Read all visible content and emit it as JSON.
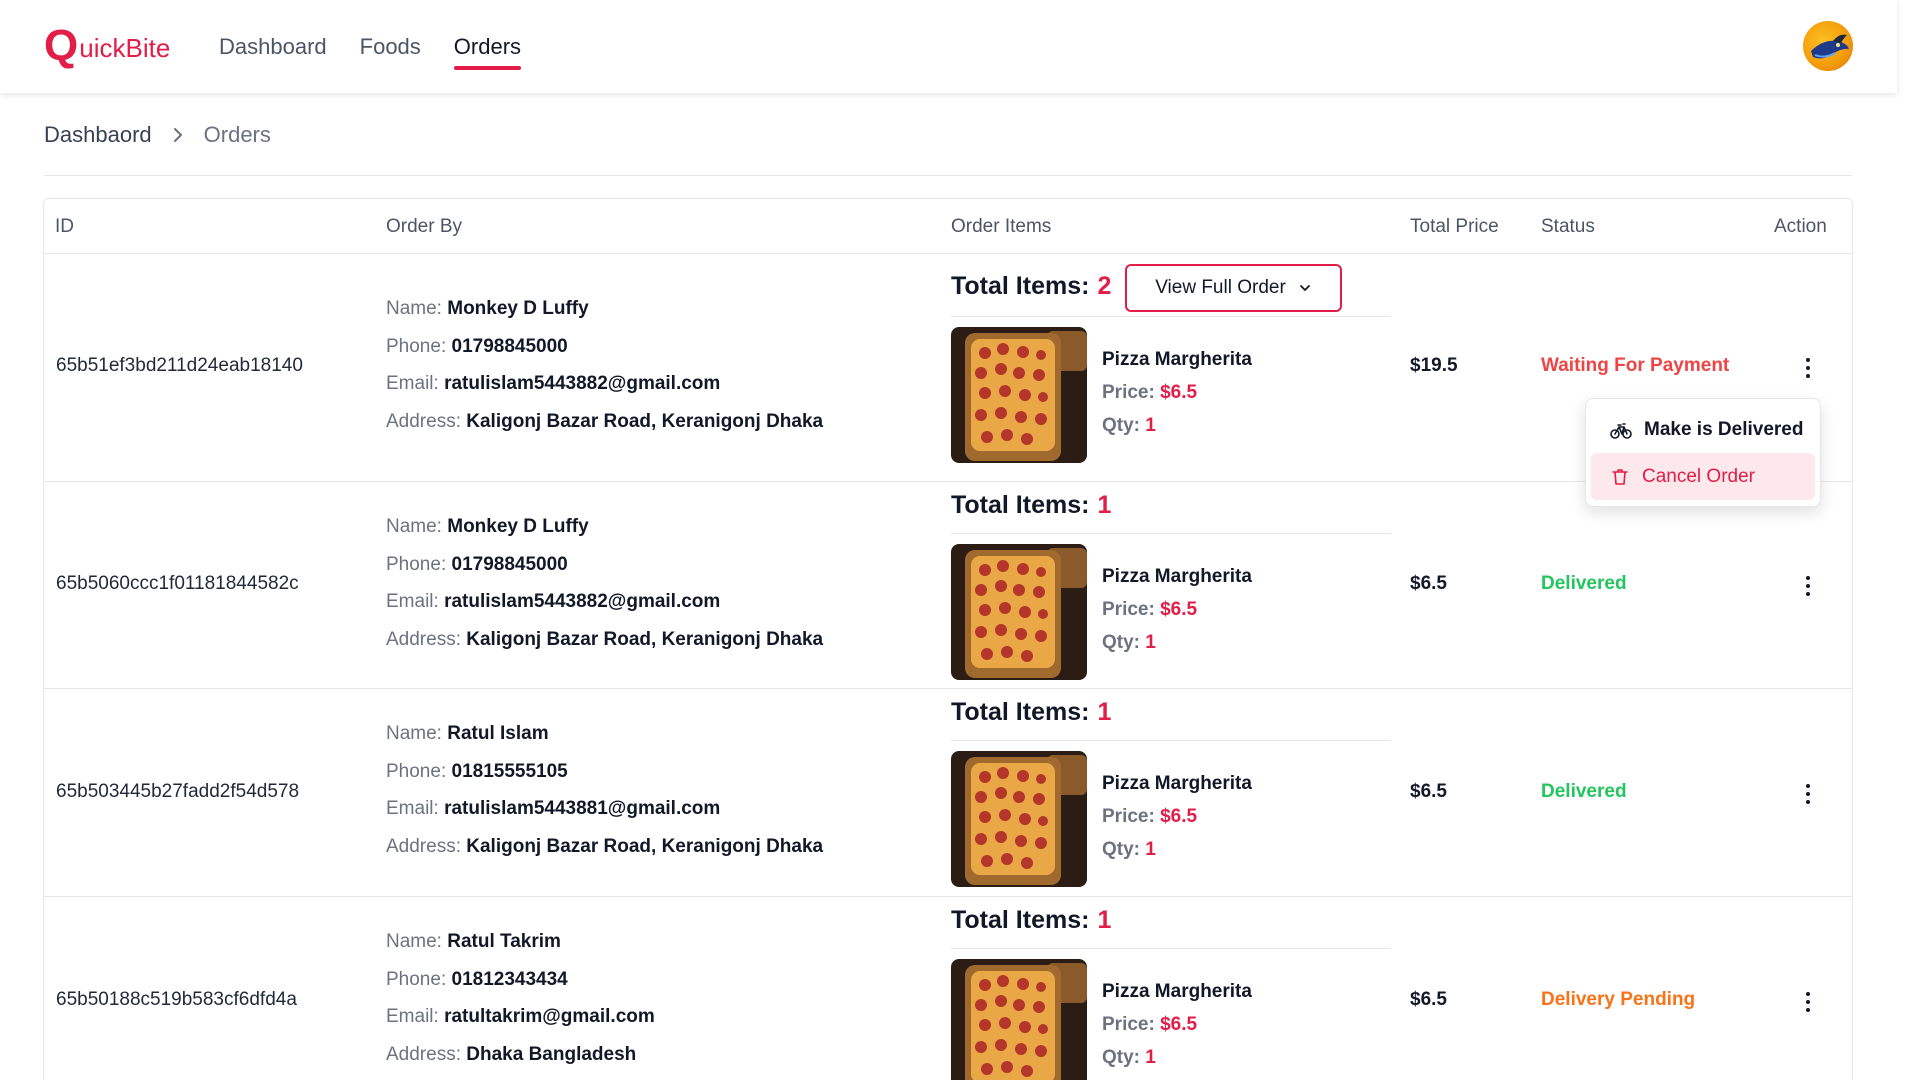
{
  "brand": {
    "logo_q": "Q",
    "logo_rest": "uickBite"
  },
  "nav": [
    {
      "label": "Dashboard",
      "active": false
    },
    {
      "label": "Foods",
      "active": false
    },
    {
      "label": "Orders",
      "active": true
    }
  ],
  "breadcrumb": {
    "home": "Dashbaord",
    "current": "Orders"
  },
  "table": {
    "headers": {
      "id": "ID",
      "order_by": "Order By",
      "order_items": "Order Items",
      "total_price": "Total Price",
      "status": "Status",
      "action": "Action"
    }
  },
  "labels": {
    "name": "Name:",
    "phone": "Phone:",
    "email": "Email:",
    "address": "Address:",
    "total_items": "Total Items:",
    "price": "Price:",
    "qty": "Qty:",
    "view_full_order": "View Full Order"
  },
  "orders": [
    {
      "id": "65b51ef3bd211d24eab18140",
      "name": "Monkey D Luffy",
      "phone": "01798845000",
      "email": "ratulislam5443882@gmail.com",
      "address": "Kaligonj Bazar Road, Keranigonj Dhaka",
      "total_items": "2",
      "item": {
        "name": "Pizza Margherita",
        "price": "$6.5",
        "qty": "1"
      },
      "total_price": "$19.5",
      "status": "Waiting For Payment"
    },
    {
      "id": "65b5060ccc1f01181844582c",
      "name": "Monkey D Luffy",
      "phone": "01798845000",
      "email": "ratulislam5443882@gmail.com",
      "address": "Kaligonj Bazar Road, Keranigonj Dhaka",
      "total_items": "1",
      "item": {
        "name": "Pizza Margherita",
        "price": "$6.5",
        "qty": "1"
      },
      "total_price": "$6.5",
      "status": "Delivered"
    },
    {
      "id": "65b503445b27fadd2f54d578",
      "name": "Ratul Islam",
      "phone": "01815555105",
      "email": "ratulislam5443881@gmail.com",
      "address": "Kaligonj Bazar Road, Keranigonj Dhaka",
      "total_items": "1",
      "item": {
        "name": "Pizza Margherita",
        "price": "$6.5",
        "qty": "1"
      },
      "total_price": "$6.5",
      "status": "Delivered"
    },
    {
      "id": "65b50188c519b583cf6dfd4a",
      "name": "Ratul Takrim",
      "phone": "01812343434",
      "email": "ratultakrim@gmail.com",
      "address": "Dhaka Bangladesh",
      "total_items": "1",
      "item": {
        "name": "Pizza Margherita",
        "price": "$6.5",
        "qty": "1"
      },
      "total_price": "$6.5",
      "status": "Delivery Pending"
    }
  ],
  "action_menu": {
    "deliver": "Make is Delivered",
    "cancel": "Cancel Order"
  },
  "colors": {
    "accent": "#e11d48",
    "waiting": "#ef4444",
    "delivered": "#22c55e",
    "pending": "#f97316"
  }
}
